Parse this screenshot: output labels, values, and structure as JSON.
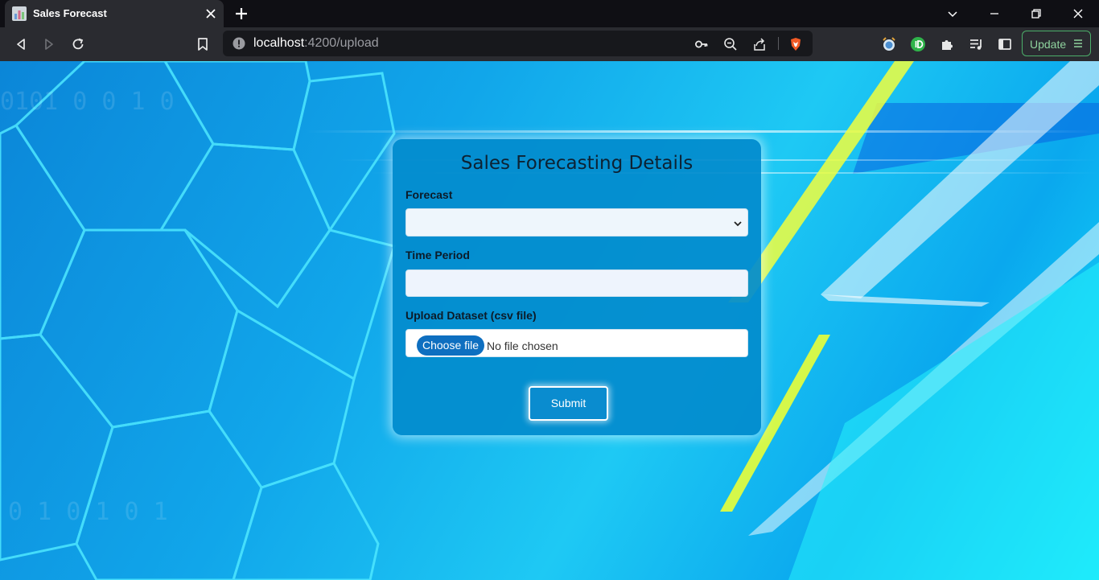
{
  "tab": {
    "title": "Sales Forecast"
  },
  "address_bar": {
    "host": "localhost",
    "path": ":4200/upload"
  },
  "toolbar": {
    "update_label": "Update"
  },
  "form": {
    "title": "Sales Forecasting Details",
    "forecast_label": "Forecast",
    "forecast_value": "",
    "time_period_label": "Time Period",
    "time_period_value": "",
    "upload_label": "Upload Dataset (csv file)",
    "choose_file_label": "Choose file",
    "no_file_text": "No file chosen",
    "submit_label": "Submit"
  },
  "colors": {
    "card_background": "#038ccd",
    "submit_border": "#ffffff",
    "choose_button": "#0e6fc0",
    "update_accent": "#4caf6a"
  }
}
